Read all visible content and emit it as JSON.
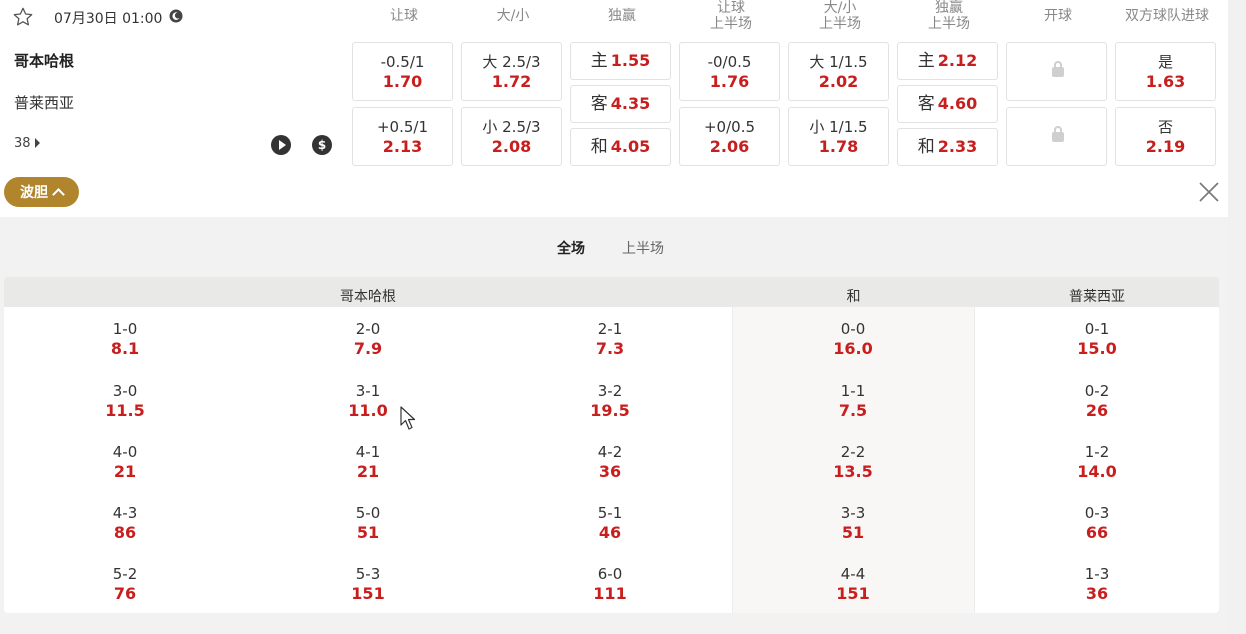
{
  "match": {
    "datetime": "07月30日 01:00",
    "home": "哥本哈根",
    "away": "普莱西亚",
    "more_count": "38"
  },
  "columns": [
    {
      "line1": "让球",
      "line2": ""
    },
    {
      "line1": "大/小",
      "line2": ""
    },
    {
      "line1": "独赢",
      "line2": ""
    },
    {
      "line1": "让球",
      "line2": "上半场"
    },
    {
      "line1": "大/小",
      "line2": "上半场"
    },
    {
      "line1": "独赢",
      "line2": "上半场"
    },
    {
      "line1": "开球",
      "line2": ""
    },
    {
      "line1": "双方球队进球",
      "line2": ""
    }
  ],
  "odds": {
    "handicap": [
      {
        "label": "-0.5/1",
        "odd": "1.70"
      },
      {
        "label": "+0.5/1",
        "odd": "2.13"
      }
    ],
    "overunder": [
      {
        "label": "大 2.5/3",
        "odd": "1.72"
      },
      {
        "label": "小 2.5/3",
        "odd": "2.08"
      }
    ],
    "moneyline": [
      {
        "label": "主",
        "odd": "1.55"
      },
      {
        "label": "客",
        "odd": "4.35"
      },
      {
        "label": "和",
        "odd": "4.05"
      }
    ],
    "handicap_half": [
      {
        "label": "-0/0.5",
        "odd": "1.76"
      },
      {
        "label": "+0/0.5",
        "odd": "2.06"
      }
    ],
    "overunder_half": [
      {
        "label": "大 1/1.5",
        "odd": "2.02"
      },
      {
        "label": "小 1/1.5",
        "odd": "1.78"
      }
    ],
    "moneyline_half": [
      {
        "label": "主",
        "odd": "2.12"
      },
      {
        "label": "客",
        "odd": "4.60"
      },
      {
        "label": "和",
        "odd": "2.33"
      }
    ],
    "btts": [
      {
        "label": "是",
        "odd": "1.63"
      },
      {
        "label": "否",
        "odd": "2.19"
      }
    ]
  },
  "correct_score": {
    "toggle_label": "波胆",
    "tabs": [
      "全场",
      "上半场"
    ],
    "headers": {
      "home": "哥本哈根",
      "draw": "和",
      "away": "普莱西亚"
    },
    "home_cols": [
      [
        {
          "s": "1-0",
          "o": "8.1"
        },
        {
          "s": "3-0",
          "o": "11.5"
        },
        {
          "s": "4-0",
          "o": "21"
        },
        {
          "s": "4-3",
          "o": "86"
        },
        {
          "s": "5-2",
          "o": "76"
        }
      ],
      [
        {
          "s": "2-0",
          "o": "7.9"
        },
        {
          "s": "3-1",
          "o": "11.0"
        },
        {
          "s": "4-1",
          "o": "21"
        },
        {
          "s": "5-0",
          "o": "51"
        },
        {
          "s": "5-3",
          "o": "151"
        }
      ],
      [
        {
          "s": "2-1",
          "o": "7.3"
        },
        {
          "s": "3-2",
          "o": "19.5"
        },
        {
          "s": "4-2",
          "o": "36"
        },
        {
          "s": "5-1",
          "o": "46"
        },
        {
          "s": "6-0",
          "o": "111"
        }
      ]
    ],
    "draw_col": [
      {
        "s": "0-0",
        "o": "16.0"
      },
      {
        "s": "1-1",
        "o": "7.5"
      },
      {
        "s": "2-2",
        "o": "13.5"
      },
      {
        "s": "3-3",
        "o": "51"
      },
      {
        "s": "4-4",
        "o": "151"
      }
    ],
    "away_col": [
      {
        "s": "0-1",
        "o": "15.0"
      },
      {
        "s": "0-2",
        "o": "26"
      },
      {
        "s": "1-2",
        "o": "14.0"
      },
      {
        "s": "0-3",
        "o": "66"
      },
      {
        "s": "1-3",
        "o": "36"
      }
    ]
  }
}
